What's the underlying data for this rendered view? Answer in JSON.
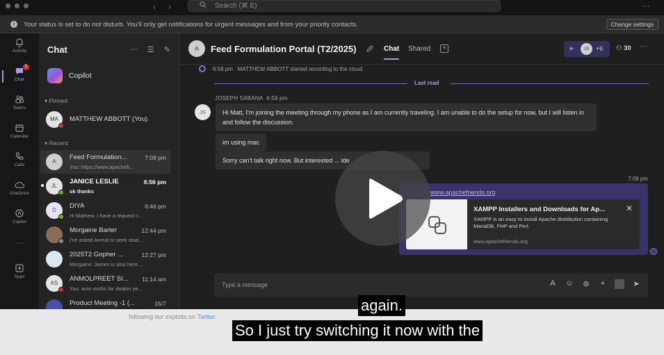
{
  "titlebar": {
    "search_placeholder": "Search (⌘ E)",
    "back": "‹",
    "forward": "›",
    "more": "···"
  },
  "banner": {
    "text": "Your status is set to do not disturb. You'll only get notifications for urgent messages and from your priority contacts.",
    "button": "Change settings"
  },
  "rail": {
    "items": [
      {
        "label": "Activity",
        "icon": "bell-icon"
      },
      {
        "label": "Chat",
        "icon": "chat-icon",
        "badge": "1"
      },
      {
        "label": "Teams",
        "icon": "teams-icon"
      },
      {
        "label": "Calendar",
        "icon": "calendar-icon"
      },
      {
        "label": "Calls",
        "icon": "phone-icon"
      },
      {
        "label": "OneDrive",
        "icon": "cloud-icon"
      },
      {
        "label": "Copilot",
        "icon": "copilot-icon"
      },
      {
        "label": "···",
        "icon": "more-icon"
      },
      {
        "label": "Apps",
        "icon": "apps-icon"
      }
    ]
  },
  "chatlist": {
    "title": "Chat",
    "copilot": "Copilot",
    "pinned_label": "Pinned",
    "recent_label": "Recent",
    "pinned": [
      {
        "name": "MATTHEW ABBOTT (You)"
      }
    ],
    "recent": [
      {
        "name": "Feed Formulation...",
        "time": "7:09 pm",
        "preview": "You: https://www.apachefr...",
        "initials": "A"
      },
      {
        "name": "JANICE LESLIE",
        "time": "6:56 pm",
        "preview": "ok thanks",
        "initials": "JL"
      },
      {
        "name": "DIYA",
        "time": "6:46 pm",
        "preview": "Hi Mathew, I have a request c...",
        "initials": "D"
      },
      {
        "name": "Morgaine Barter",
        "time": "12:44 pm",
        "preview": "I've asked Anmol to seek stud...",
        "initials": ""
      },
      {
        "name": "2025T2 Gopher ...",
        "time": "12:27 pm",
        "preview": "Morgaine: James is also here ...",
        "initials": ""
      },
      {
        "name": "ANMOLPREET SI...",
        "time": "11:14 am",
        "preview": "You: aron works for deakin ye...",
        "initials": "AS"
      },
      {
        "name": "Product Meeting -1 (...",
        "time": "15/7",
        "preview": "",
        "initials": ""
      }
    ]
  },
  "main": {
    "avatar": "A",
    "title": "Feed Formulation Portal (T2/2025)",
    "tabs": [
      "Chat",
      "Shared"
    ],
    "call_avatar": "JS",
    "call_count": "+6",
    "participants": "30",
    "system_time": "6:58 pm",
    "system_text": "MATTHEW ABBOTT started recording to the cloud",
    "last_read": "Last read",
    "sender": "JOSEPH SABANA",
    "sender_time": "6:58 pm",
    "sender_initials": "JS",
    "messages": [
      "Hi Matt, I'm joining the meeting through my phone as I am currently traveling. I am unable to do the setup for now, but I will listen in and follow the discussion.",
      "im using mac",
      "Sorry can't talk right now. But interested ... ide"
    ],
    "my_time": "7:09 pm",
    "my_link": "www.apachefriends.org",
    "preview_title": "XAMPP Installers and Downloads for Ap...",
    "preview_desc": "XAMPP is an easy to install Apache distribution containing MariaDB, PHP and Perl.",
    "preview_domain": "www.apachefriends.org",
    "compose_placeholder": "Type a message"
  },
  "desktop": {
    "text_before": "following our exploits on ",
    "link": "Twitter",
    "text_after": "."
  },
  "captions": {
    "line1": "again.",
    "line2": "So I just try switching it now with the"
  },
  "colors": {
    "accent": "#a99be8",
    "app_bg": "#1f1f1f",
    "card": "#38346a"
  }
}
